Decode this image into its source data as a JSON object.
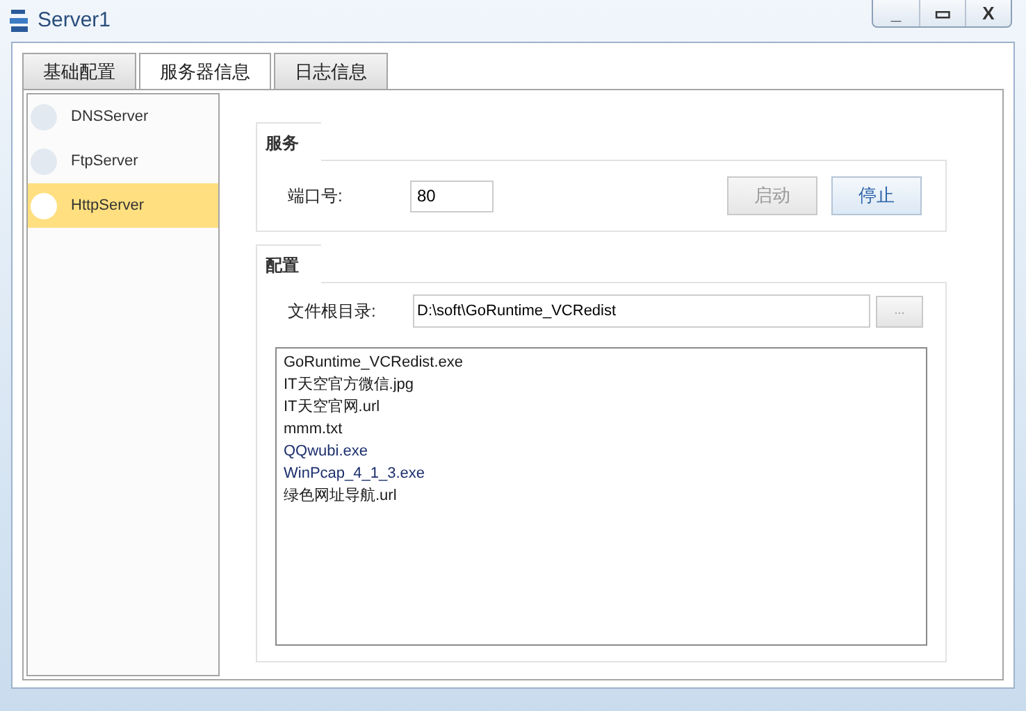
{
  "window": {
    "title": "Server1",
    "controls": [
      "_",
      "▭",
      "X"
    ]
  },
  "tabs": [
    {
      "label": "基础配置",
      "selected": false
    },
    {
      "label": "服务器信息",
      "selected": true
    },
    {
      "label": "日志信息",
      "selected": false
    }
  ],
  "servers": [
    {
      "label": "DNSServer",
      "selected": false
    },
    {
      "label": "FtpServer",
      "selected": false
    },
    {
      "label": "HttpServer",
      "selected": true
    }
  ],
  "service": {
    "title": "服务",
    "port_label": "端口号:",
    "port_value": "80",
    "buttons": [
      {
        "label": "启动",
        "disabled": true
      },
      {
        "label": "停止",
        "disabled": false
      }
    ]
  },
  "config": {
    "title": "配置",
    "root_label": "文件根目录:",
    "root_value": "D:\\soft\\GoRuntime_VCRedist",
    "browse": "...",
    "files": [
      {
        "name": "GoRuntime_VCRedist.exe",
        "color": "#1a1a1a"
      },
      {
        "name": "IT天空官方微信.jpg",
        "color": "#1a1a1a"
      },
      {
        "name": "IT天空官网.url",
        "color": "#1a1a1a"
      },
      {
        "name": "mmm.txt",
        "color": "#1a1a1a"
      },
      {
        "name": "QQwubi.exe",
        "color": "#1c2f6e"
      },
      {
        "name": "WinPcap_4_1_3.exe",
        "color": "#1c2f6e"
      },
      {
        "name": "绿色网址导航.url",
        "color": "#1a1a1a"
      }
    ]
  }
}
